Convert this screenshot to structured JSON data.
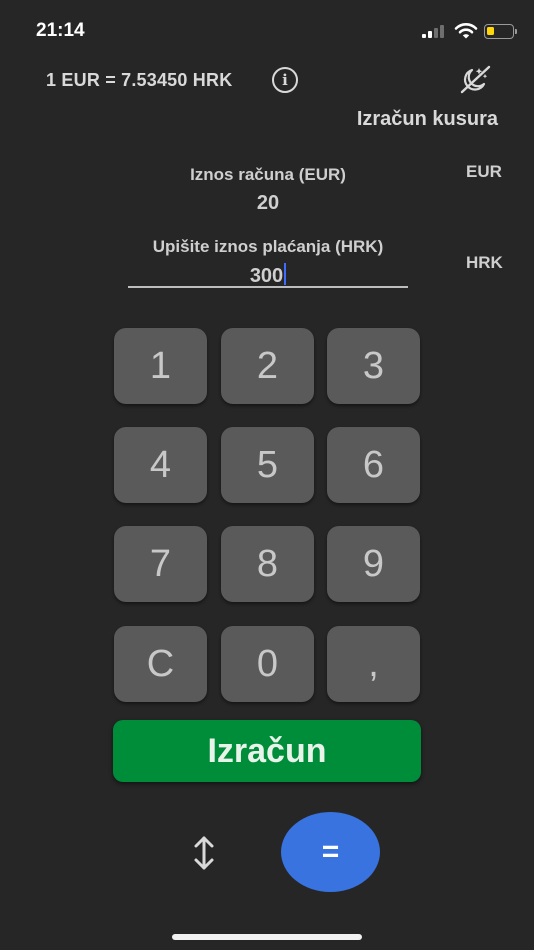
{
  "status_bar": {
    "time": "21:14",
    "signal_icon": "cellular-signal-icon",
    "wifi_icon": "wifi-icon",
    "battery_icon": "battery-icon",
    "battery_level": 0.3,
    "battery_color": "#ffd60a"
  },
  "header": {
    "exchange_rate": "1 EUR = 7.53450 HRK",
    "info_icon": "info-icon",
    "info_glyph": "i",
    "theme_icon": "dark-mode-toggle-icon",
    "mode_title": "Izračun kusura"
  },
  "bill_field": {
    "label": "Iznos računa (EUR)",
    "value": "20",
    "currency": "EUR"
  },
  "payment_field": {
    "label": "Upišite iznos plaćanja (HRK)",
    "value": "300",
    "currency": "HRK"
  },
  "keypad": {
    "keys": [
      "1",
      "2",
      "3",
      "4",
      "5",
      "6",
      "7",
      "8",
      "9",
      "C",
      "0",
      ","
    ]
  },
  "actions": {
    "calculate_label": "Izračun",
    "calculate_color": "#008d3a",
    "swap_icon": "swap-vertical-icon",
    "equals_label": "=",
    "equals_color": "#3873e0"
  },
  "colors": {
    "background": "#262626",
    "key_background": "#5a5a5a",
    "caret": "#3f6bff"
  }
}
